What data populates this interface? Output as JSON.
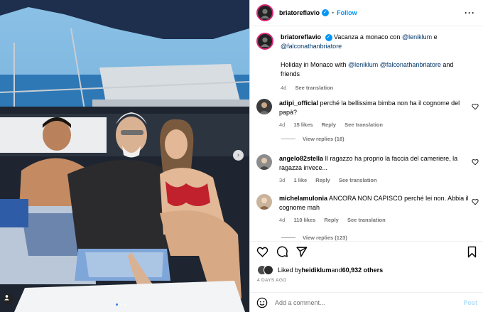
{
  "header": {
    "username": "briatoreflavio",
    "separator": "•",
    "follow_label": "Follow",
    "more_icon": "more-icon"
  },
  "caption": {
    "username": "briatoreflavio",
    "text_1": "Vacanza a monaco con ",
    "mention_1": "@leniklum",
    "text_2": " e ",
    "mention_2": "@falconathanbriatore",
    "english_1": "Holiday in Monaco with ",
    "english_mention_1": "@leniklum",
    "english_mention_2": "@falconathanbriatore",
    "english_2": " and friends",
    "time": "4d",
    "see_translation": "See translation"
  },
  "comments": [
    {
      "username": "adipi_official",
      "text": "perché la bellissima bimba non ha il cognome del papà?",
      "time": "4d",
      "likes": "15 likes",
      "reply": "Reply",
      "see_translation": "See translation",
      "view_replies": "View replies (18)"
    },
    {
      "username": "angelo82stella",
      "text": "Il ragazzo ha proprio la faccia del cameriere, la ragazza invece...",
      "time": "3d",
      "likes": "1 like",
      "reply": "Reply",
      "see_translation": "See translation"
    },
    {
      "username": "michelamulonia",
      "text": "ANCORA NON CAPISCO perché lei non. Abbia il cognome mah",
      "time": "4d",
      "likes": "110 likes",
      "reply": "Reply",
      "see_translation": "See translation",
      "view_replies": "View replies (123)"
    }
  ],
  "likes": {
    "prefix": "Liked by ",
    "user": "heidiklum",
    "and": " and ",
    "count": "60,932 others"
  },
  "posted_ago": "4 DAYS AGO",
  "add_comment": {
    "placeholder": "Add a comment...",
    "post_label": "Post"
  },
  "carousel": {
    "total_slides": 3,
    "active_slide": 1,
    "next_glyph": "›"
  },
  "colors": {
    "accent": "#0095f6",
    "link": "#00376b",
    "muted": "#737373",
    "story_ring": "#d62976",
    "post_disabled": "#b2dffc"
  },
  "icons": [
    "heart-icon",
    "comment-icon",
    "share-icon",
    "bookmark-icon",
    "emoji-icon",
    "verified-icon",
    "user-tag-icon",
    "chevron-right-icon"
  ]
}
